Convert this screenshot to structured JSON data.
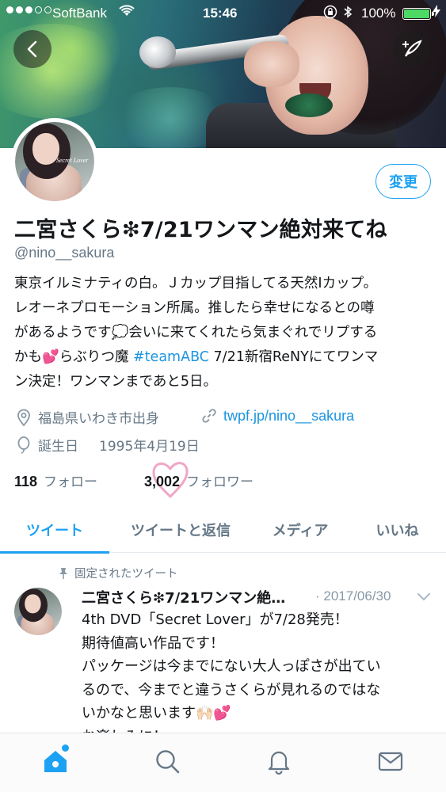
{
  "status_bar": {
    "carrier": "SoftBank",
    "time": "15:46",
    "battery_percent": "100%",
    "signal_dots_filled": 3,
    "signal_dots_total": 5
  },
  "header": {
    "back_icon": "chevron-left-icon",
    "compose_icon": "compose-quill-icon"
  },
  "profile": {
    "edit_button_label": "変更",
    "display_name": "二宮さくら❇︎7/21ワンマン絶対来てね",
    "handle": "@nino__sakura",
    "bio_line1": "東京イルミナティの白。Ｊカップ目指してる天然Iカップ。",
    "bio_line2": "レオーネプロモーション所属。推したら幸せになるとの噂",
    "bio_line3": "があるようです💭会いに来てくれたら気まぐれでリプする",
    "bio_line4a": "かも💕らぶりつ魔 ",
    "bio_hashtag": "#teamABC",
    "bio_line4b": " 7/21新宿ReNYにてワンマ",
    "bio_line5": "ン決定！ワンマンまであと5日。",
    "location": "福島県いわき市出身",
    "website": "twpf.jp/nino__sakura",
    "birthday_label": "誕生日",
    "birthday": "1995年4月19日",
    "following_count": "118",
    "following_label": "フォロー",
    "followers_count": "3,002",
    "followers_label": "フォロワー"
  },
  "tabs": [
    {
      "label": "ツイート",
      "active": true
    },
    {
      "label": "ツイートと返信",
      "active": false
    },
    {
      "label": "メディア",
      "active": false
    },
    {
      "label": "いいね",
      "active": false
    }
  ],
  "pinned_tweet": {
    "pinned_label": "固定されたツイート",
    "author": "二宮さくら❇︎7/21ワンマン絶…",
    "date": "· 2017/06/30",
    "text": "4th DVD「Secret Lover」が7/28発売！\n期待値高い作品です！\nパッケージは今までにない大人っぽさが出てい\nるので、今までと違うさくらが見れるのではな\nいかなと思います🙌🏻💕\nお楽しみに！"
  },
  "avatar_overlay_text": "Secret Lover",
  "tab_bar": {
    "items": [
      "home-icon",
      "search-icon",
      "notifications-icon",
      "messages-icon"
    ],
    "active": "home-icon"
  },
  "colors": {
    "accent": "#1da1f2",
    "link": "#1b95e0",
    "secondary_text": "#657786",
    "heart_doodle": "#f0a7c7"
  }
}
